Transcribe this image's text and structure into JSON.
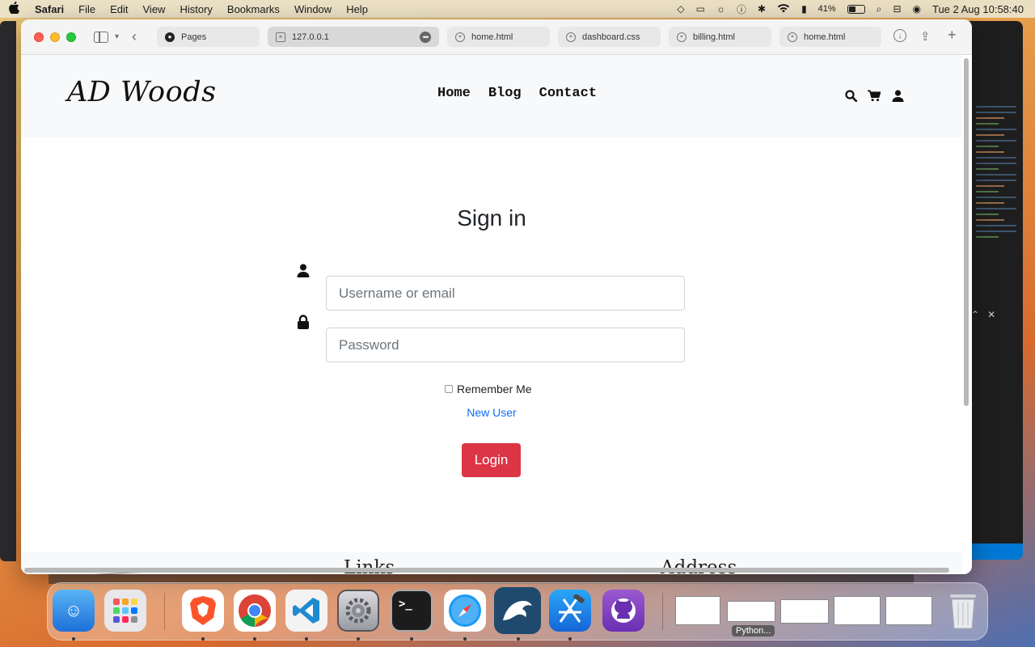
{
  "menubar": {
    "app_name": "Safari",
    "menus": [
      "File",
      "Edit",
      "View",
      "History",
      "Bookmarks",
      "Window",
      "Help"
    ],
    "battery": "41%",
    "datetime": "Tue 2 Aug  10:58:40"
  },
  "browser": {
    "tabs": [
      {
        "label": "Pages",
        "icon": "github-icon"
      },
      {
        "label": "127.0.0.1",
        "icon": "close-box-icon"
      },
      {
        "label": "home.html",
        "icon": "compass-icon"
      },
      {
        "label": "dashboard.css",
        "icon": "compass-icon"
      },
      {
        "label": "billing.html",
        "icon": "compass-icon"
      },
      {
        "label": "home.html",
        "icon": "compass-icon"
      }
    ]
  },
  "site": {
    "logo": "AD Woods",
    "nav": [
      "Home",
      "Blog",
      "Contact"
    ]
  },
  "signin": {
    "title": "Sign in",
    "username_placeholder": "Username or email",
    "password_placeholder": "Password",
    "remember_label": "Remember Me",
    "new_user_link": "New User",
    "login_button": "Login"
  },
  "footer": {
    "links_heading": "Links",
    "address_heading": "Address"
  },
  "dock": {
    "hover_label": "Python..."
  },
  "colors": {
    "login_button": "#dc3545",
    "link": "#0d6efd",
    "header_bg": "#f8f9fa"
  }
}
